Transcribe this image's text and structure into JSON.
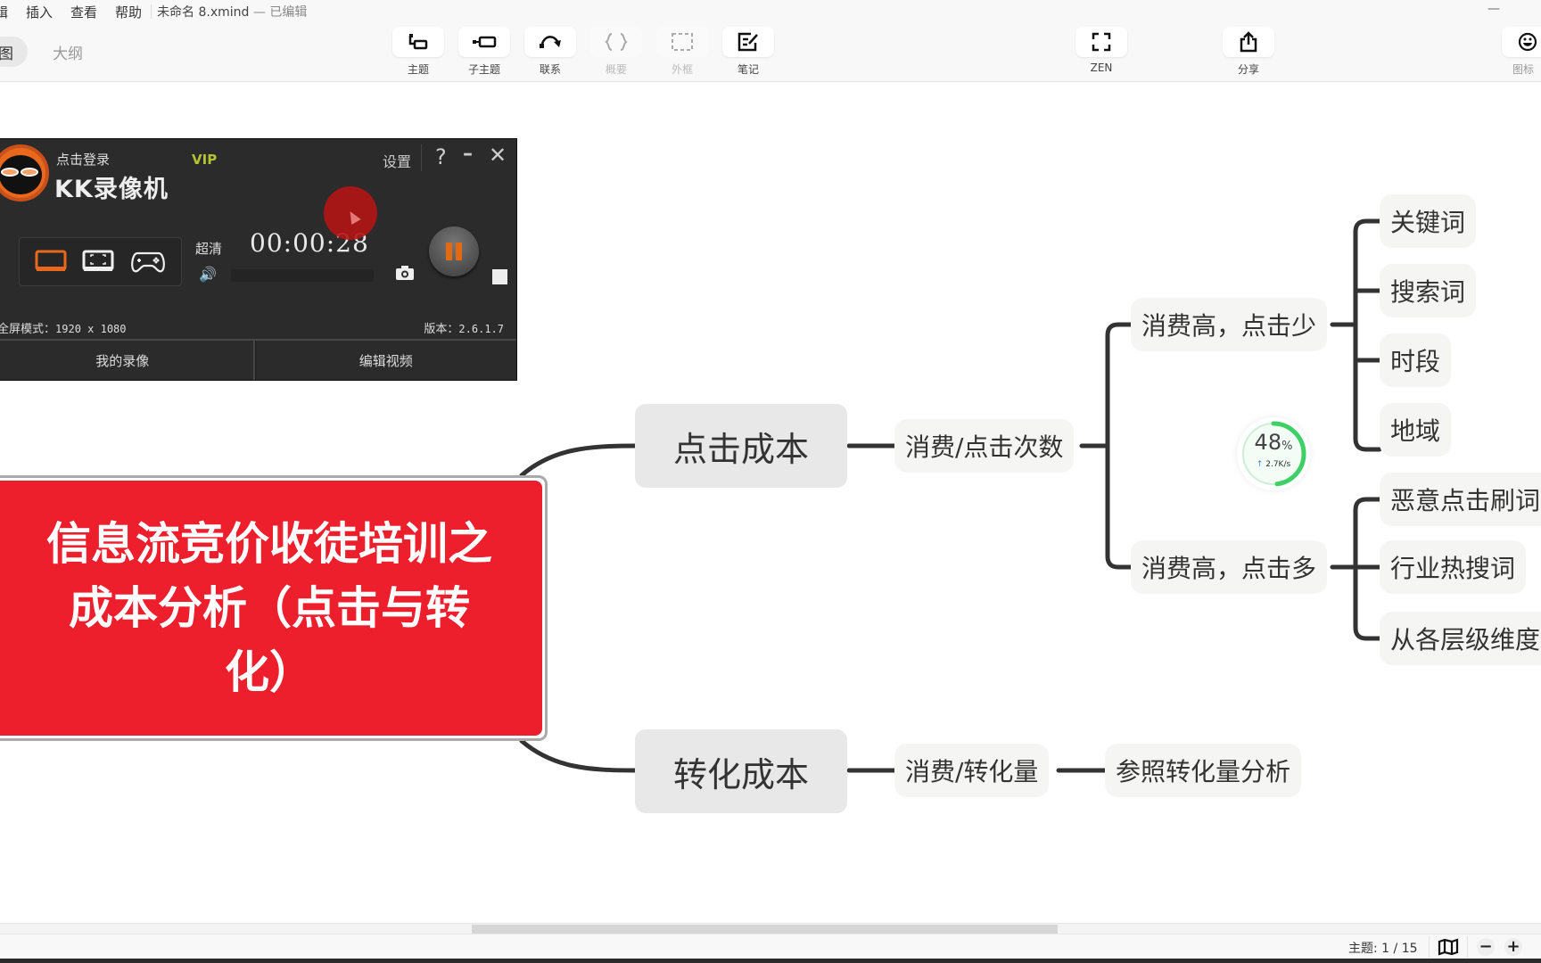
{
  "menubar": {
    "items": [
      "编辑",
      "插入",
      "查看",
      "帮助"
    ],
    "visible_first_fragment": "辑",
    "doc_name": "未命名 8.xmind",
    "doc_status": " — 已编辑"
  },
  "viewtabs": {
    "mindmap_fragment": "图",
    "outline": "大纲"
  },
  "toolbar": {
    "topic": "主题",
    "subtopic": "子主题",
    "relationship": "联系",
    "summary": "概要",
    "boundary": "外框",
    "note": "笔记",
    "zen": "ZEN",
    "share": "分享",
    "icon": "图标"
  },
  "mindmap": {
    "central": {
      "line1": "信息流竞价收徒培训之",
      "line2": "成本分析（点击与转",
      "line3": "化）",
      "fill_color": "#ee1f2d"
    },
    "branches": [
      {
        "label": "点击成本",
        "children": [
          {
            "label": "消费/点击次数",
            "children": [
              {
                "label": "消费高，点击少",
                "children": [
                  "关键词",
                  "搜索词",
                  "时段",
                  "地域"
                ]
              },
              {
                "label": "消费高，点击多",
                "children": [
                  "恶意点击刷词",
                  "行业热搜词",
                  "从各层级维度"
                ]
              }
            ]
          }
        ]
      },
      {
        "label": "转化成本",
        "children": [
          {
            "label": "消费/转化量",
            "children": [
              {
                "label": "参照转化量分析"
              }
            ]
          }
        ]
      }
    ]
  },
  "speed_widget": {
    "percent": 48,
    "percent_text": "48",
    "percent_sign": "%",
    "arrow": "↑",
    "rate": "2.7K/s",
    "color": "#3fcf67"
  },
  "recorder": {
    "login": "点击登录",
    "vip": "VIP",
    "brand": "KK录像机",
    "settings": "设置",
    "help": "?",
    "minimize": "–",
    "close": "✕",
    "quality": "超清",
    "timer": "00:00:28",
    "fullscreen_label": "全屏模式：",
    "resolution": "1920 x 1080",
    "version_label": "版本：",
    "version": "2.6.1.7",
    "my_recordings": "我的录像",
    "edit_video": "编辑视频",
    "accent": "#e8691d"
  },
  "statusbar": {
    "topic_count": "主题: 1 / 15",
    "zoom_out": "−",
    "zoom_in": "+"
  }
}
